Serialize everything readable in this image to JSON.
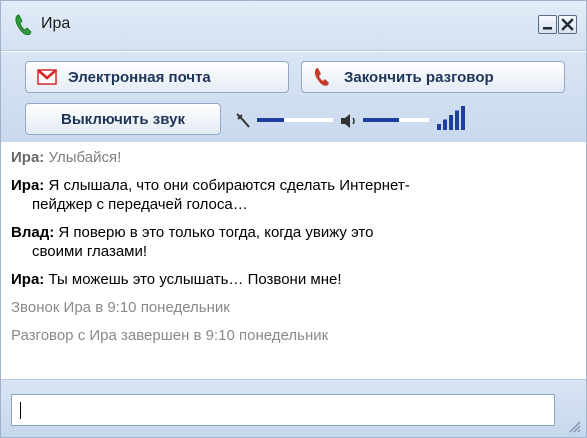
{
  "window": {
    "title": "Ира",
    "controls": [
      "minimize",
      "close"
    ]
  },
  "toolbar": {
    "email_label": "Электронная почта",
    "hangup_label": "Закончить разговор",
    "mute_label": "Выключить звук",
    "mic_level": 0.35,
    "speaker_level": 0.55,
    "signal_bars": 5
  },
  "messages": [
    {
      "sender": "Ира:",
      "text": "Улыбайся!",
      "faded": true
    },
    {
      "sender": "Ира:",
      "text": "Я слышала, что они собираются сделать Интернет-",
      "cont": "пейджер с передачей голоса…"
    },
    {
      "sender": "Влад:",
      "text": "Я поверю в это только тогда, когда увижу это",
      "cont": "своими глазами!"
    },
    {
      "sender": "Ира:",
      "text": "Ты можешь это услышать… Позвони мне!"
    }
  ],
  "system": [
    "Звонок Ира  в 9:10 понедельник",
    "Разговор с Ира завершен в 9:10  понедельник"
  ],
  "input": {
    "value": ""
  },
  "colors": {
    "accent": "#c9d9ee",
    "email_icon": "#d62828",
    "hangup_icon": "#c73a2a",
    "phone_icon": "#2f9a3a",
    "level_bar": "#1f3f9e"
  },
  "icons": [
    "phone-icon",
    "minimize-icon",
    "close-icon",
    "gmail-icon",
    "hangup-phone-icon",
    "microphone-icon",
    "speaker-icon",
    "signal-strength-icon",
    "resize-grip-icon"
  ]
}
